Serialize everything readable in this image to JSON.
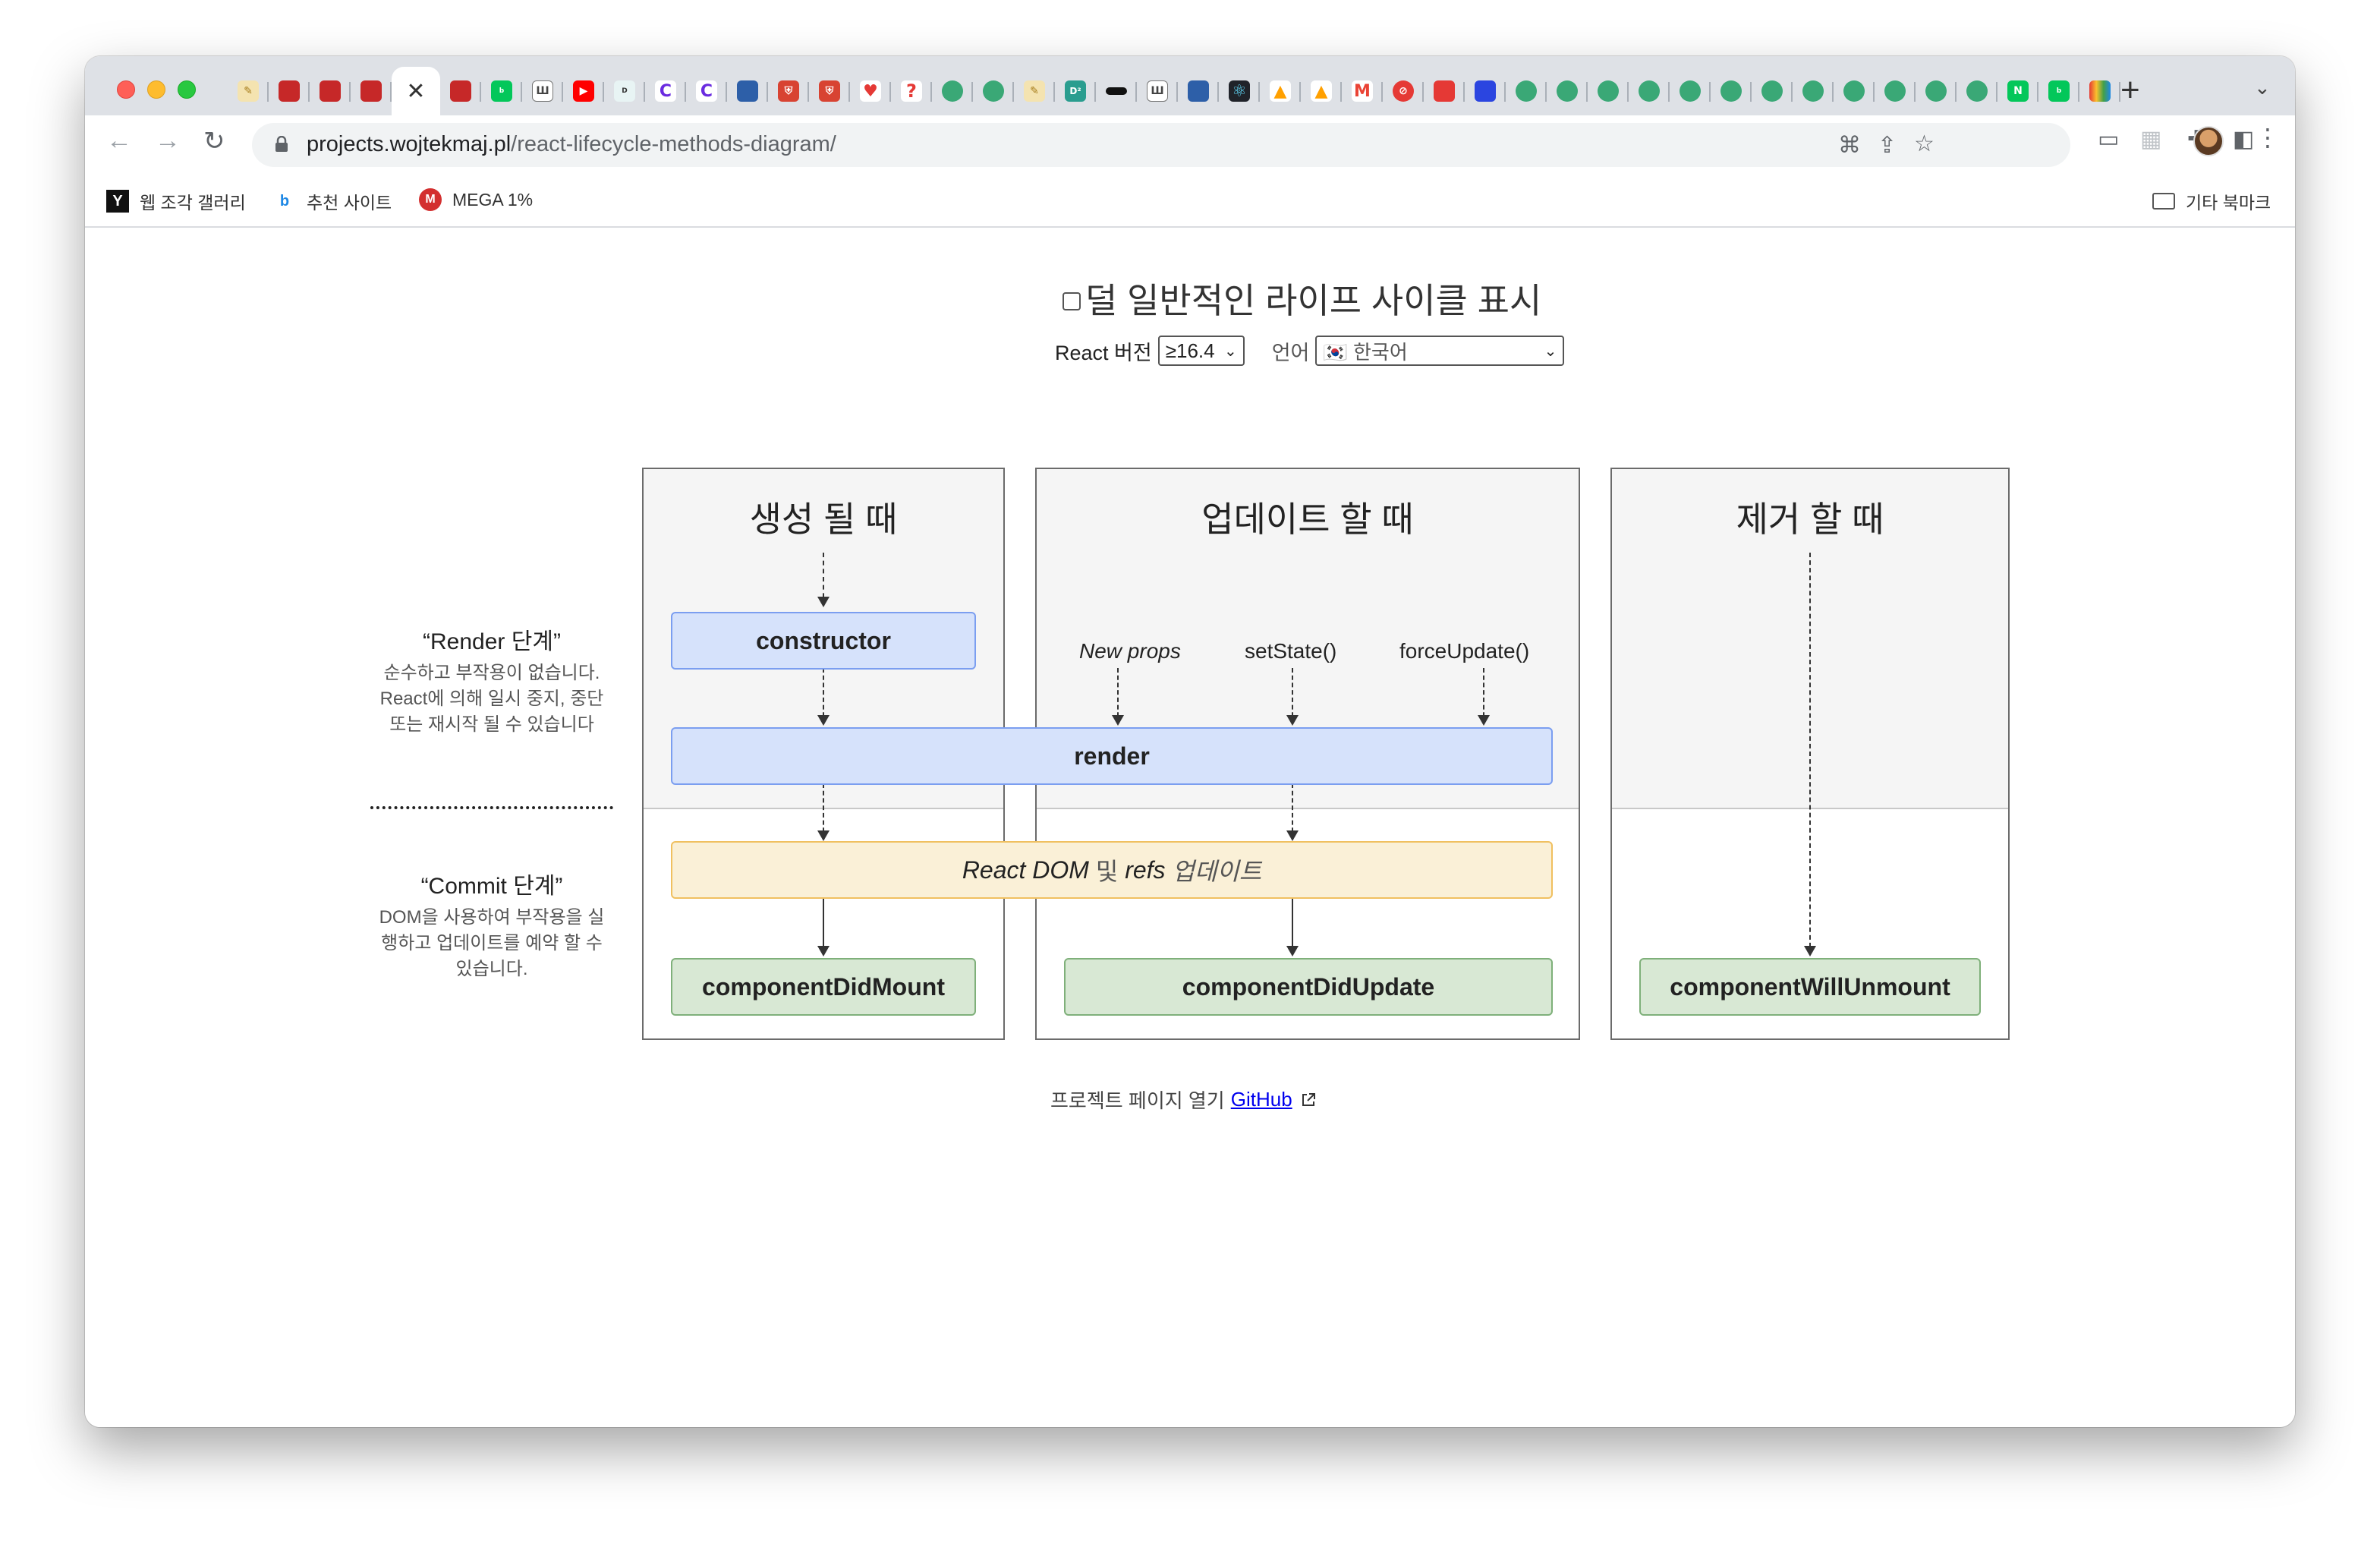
{
  "browser": {
    "url_host": "projects.wojtekmaj.pl",
    "url_path": "/react-lifecycle-methods-diagram/",
    "tab_close_glyph": "✕",
    "newtab_glyph": "+",
    "bookmarks": [
      {
        "label": "웹 조각 갤러리",
        "icon": "web-clip-icon"
      },
      {
        "label": "추천 사이트",
        "icon": "bing-icon"
      },
      {
        "label": "MEGA 1%",
        "icon": "mega-icon"
      }
    ],
    "other_bookmarks": "기타 북마크"
  },
  "page": {
    "toggle_label": "덜 일반적인 라이프 사이클 표시",
    "react_version_label": "React 버전",
    "react_version_value": "≥16.4",
    "language_label": "언어",
    "language_value": "🇰🇷 한국어",
    "columns": {
      "mount": {
        "title": "생성 될 때",
        "box_top": "constructor",
        "box_bottom": "componentDidMount"
      },
      "update": {
        "title": "업데이트 할 때",
        "trigger1": "New props",
        "trigger2": "setState()",
        "trigger3": "forceUpdate()",
        "box_bottom": "componentDidUpdate"
      },
      "unmount": {
        "title": "제거 할 때",
        "box_bottom": "componentWillUnmount"
      }
    },
    "render_box": "render",
    "dom_box_part1": "React DOM",
    "dom_box_part2": "및",
    "dom_box_part3": "refs",
    "dom_box_part4": "업데이트",
    "render_phase": {
      "title": "“Render 단계”",
      "desc": "순수하고 부작용이 없습니다. React에 의해 일시 중지, 중단 또는 재시작 될 수 있습니다"
    },
    "commit_phase": {
      "title": "“Commit 단계”",
      "desc": "DOM을 사용하여 부작용을 실행하고 업데이트를 예약 할 수 있습니다."
    },
    "footer_text": "프로젝트 페이지 열기",
    "footer_link": "GitHub"
  }
}
